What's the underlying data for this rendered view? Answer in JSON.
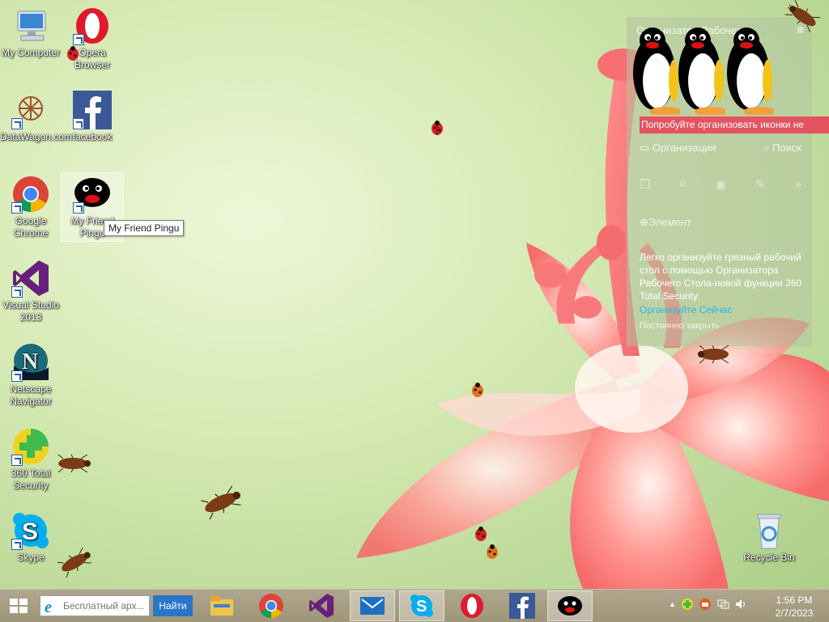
{
  "desktop": {
    "icons": [
      {
        "label": "My Computer"
      },
      {
        "label": "Opera Browser"
      },
      {
        "label": "DataWagon.com"
      },
      {
        "label": "facebook"
      },
      {
        "label": "Google Chrome"
      },
      {
        "label": "My Friend Pingu"
      },
      {
        "label": "Visual Studio 2013"
      },
      {
        "label": "Netscape Navigator"
      },
      {
        "label": "360 Total Security"
      },
      {
        "label": "Skype"
      },
      {
        "label": "Recycle Bin"
      }
    ],
    "tooltip": "My Friend Pingu"
  },
  "organizer": {
    "title": "Организатор Рабочего",
    "banner": "Попробуйте организовать иконки не",
    "organize_label": "Организация",
    "search_label": "Поиск",
    "element_label": "Элемент",
    "description": "Легко организуйте грязный рабочий стол с помощью Организатора Рабочего Стола-новой функции 360 Total Security.",
    "link": "Организуйте Сейчас",
    "close_label": "Постоянно закрыть"
  },
  "taskbar": {
    "search_placeholder": "Бесплатный арх...",
    "search_button": "Найти",
    "apps": [
      "file-explorer-icon",
      "chrome-icon",
      "visual-studio-icon",
      "mail-icon",
      "skype-icon",
      "opera-icon",
      "facebook-icon",
      "pingu-icon"
    ],
    "clock_time": "1:56 PM",
    "clock_date": "2/7/2023"
  },
  "colors": {
    "taskbar": "#a99f85",
    "banner": "#e35360",
    "link": "#29b6e8",
    "search_button": "#2b75c9"
  }
}
